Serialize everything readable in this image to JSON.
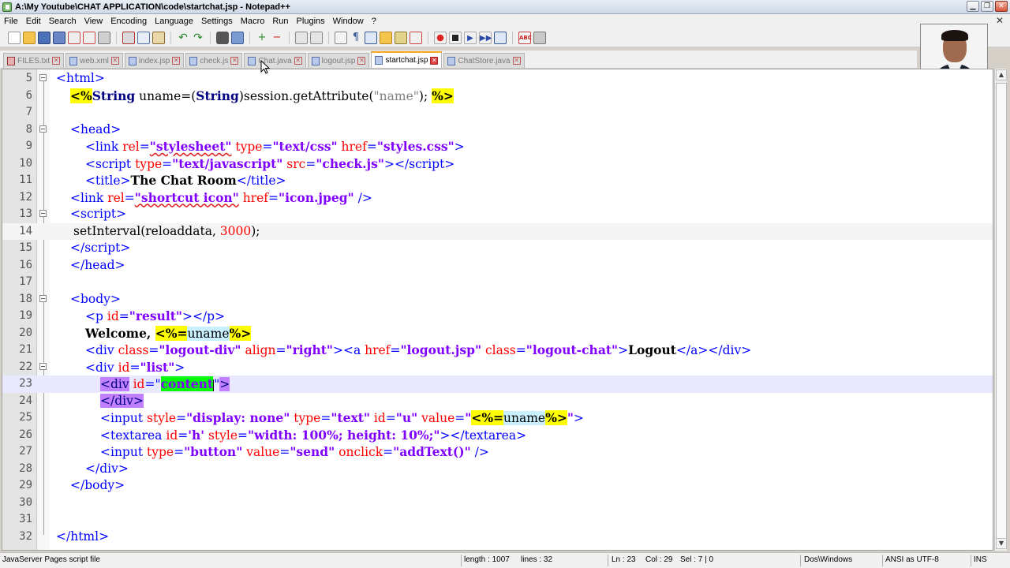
{
  "window": {
    "title": "A:\\My Youtube\\CHAT APPLICATION\\code\\startchat.jsp - Notepad++"
  },
  "menu": [
    "File",
    "Edit",
    "Search",
    "View",
    "Encoding",
    "Language",
    "Settings",
    "Macro",
    "Run",
    "Plugins",
    "Window",
    "?"
  ],
  "tabs": [
    {
      "label": "FILES.txt",
      "active": false
    },
    {
      "label": "web.xml",
      "active": false
    },
    {
      "label": "index.jsp",
      "active": false
    },
    {
      "label": "check.js",
      "active": false
    },
    {
      "label": "Chat.java",
      "active": false
    },
    {
      "label": "logout.jsp",
      "active": false
    },
    {
      "label": "startchat.jsp",
      "active": true
    },
    {
      "label": "ChatStore.java",
      "active": false
    }
  ],
  "editor": {
    "line_numbers": [
      "5",
      "6",
      "7",
      "8",
      "9",
      "10",
      "11",
      "12",
      "13",
      "14",
      "15",
      "16",
      "17",
      "18",
      "19",
      "20",
      "21",
      "22",
      "23",
      "24",
      "25",
      "26",
      "27",
      "28",
      "29",
      "30",
      "31",
      "32"
    ]
  },
  "status": {
    "file_type": "JavaServer Pages script file",
    "length": "length : 1007",
    "lines": "lines : 32",
    "ln": "Ln : 23",
    "col": "Col : 29",
    "sel": "Sel : 7 | 0",
    "eol": "Dos\\Windows",
    "encoding": "ANSI as UTF-8",
    "mode": "INS"
  },
  "colors": {
    "tag": "#0000ff",
    "attribute": "#ff0000",
    "value": "#8000ff",
    "jsp_highlight": "#ffff00",
    "current_line": "#e8e8ff"
  }
}
